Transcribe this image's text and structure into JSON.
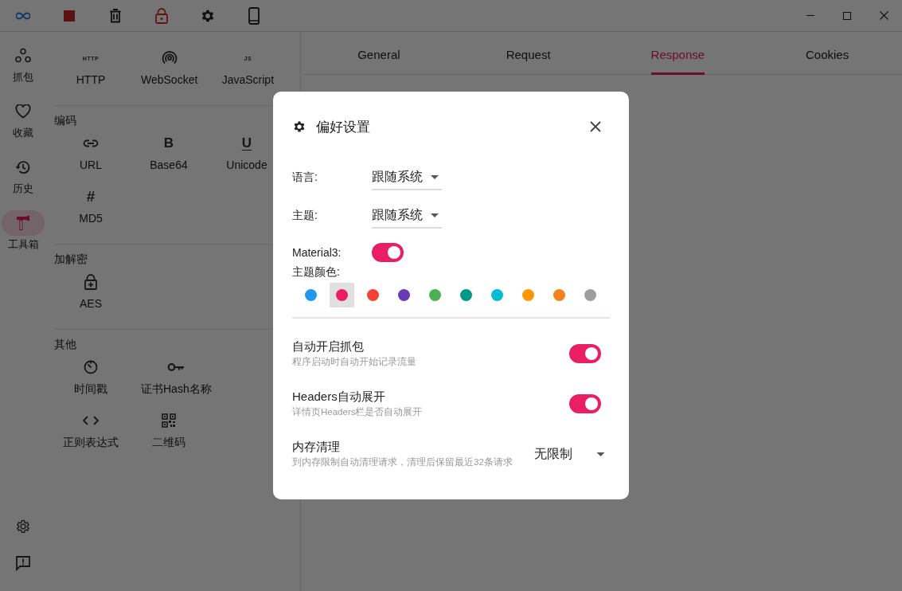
{
  "nav": {
    "items": [
      {
        "label": "抓包",
        "selected": false
      },
      {
        "label": "收藏",
        "selected": false
      },
      {
        "label": "历史",
        "selected": false
      },
      {
        "label": "工具箱",
        "selected": true
      }
    ]
  },
  "tools": {
    "sections": [
      {
        "items": [
          {
            "label": "HTTP",
            "glyph": "HTTP"
          },
          {
            "label": "WebSocket"
          },
          {
            "label": "JavaScript",
            "glyph": "JS"
          }
        ]
      },
      {
        "title": "编码",
        "items": [
          {
            "label": "URL"
          },
          {
            "label": "Base64",
            "glyph": "B"
          },
          {
            "label": "Unicode",
            "glyph": "U"
          },
          {
            "label": "MD5",
            "glyph": "#"
          }
        ]
      },
      {
        "title": "加解密",
        "items": [
          {
            "label": "AES"
          }
        ]
      },
      {
        "title": "其他",
        "items": [
          {
            "label": "时间戳"
          },
          {
            "label": "证书Hash名称"
          },
          {
            "label": "正则表达式"
          },
          {
            "label": "二维码"
          }
        ]
      }
    ]
  },
  "tabs": [
    {
      "label": "General",
      "selected": false
    },
    {
      "label": "Request",
      "selected": false
    },
    {
      "label": "Response",
      "selected": true
    },
    {
      "label": "Cookies",
      "selected": false
    }
  ],
  "dialog": {
    "title": "偏好设置",
    "fields": [
      {
        "label": "语言:",
        "value": "跟随系统"
      },
      {
        "label": "主题:",
        "value": "跟随系统"
      }
    ],
    "material3": {
      "label": "Material3:",
      "on": true
    },
    "theme_color": {
      "label": "主题颜色:",
      "swatches": [
        {
          "color": "#2196f3",
          "selected": false
        },
        {
          "color": "#e91e63",
          "selected": true
        },
        {
          "color": "#f44336",
          "selected": false
        },
        {
          "color": "#673ab7",
          "selected": false
        },
        {
          "color": "#4caf50",
          "selected": false
        },
        {
          "color": "#009688",
          "selected": false
        },
        {
          "color": "#00bcd4",
          "selected": false
        },
        {
          "color": "#ff9800",
          "selected": false
        },
        {
          "color": "#f5821f",
          "selected": false
        },
        {
          "color": "#9e9e9e",
          "selected": false
        }
      ]
    },
    "settings": [
      {
        "kind": "switch",
        "title": "自动开启抓包",
        "subtitle": "程序启动时自动开始记录流量",
        "on": true
      },
      {
        "kind": "switch",
        "title": "Headers自动展开",
        "subtitle": "详情页Headers栏是否自动展开",
        "on": true
      },
      {
        "kind": "select",
        "title": "内存清理",
        "subtitle": "到内存限制自动清理请求，清理后保留最近32条请求",
        "value": "无限制"
      }
    ]
  }
}
